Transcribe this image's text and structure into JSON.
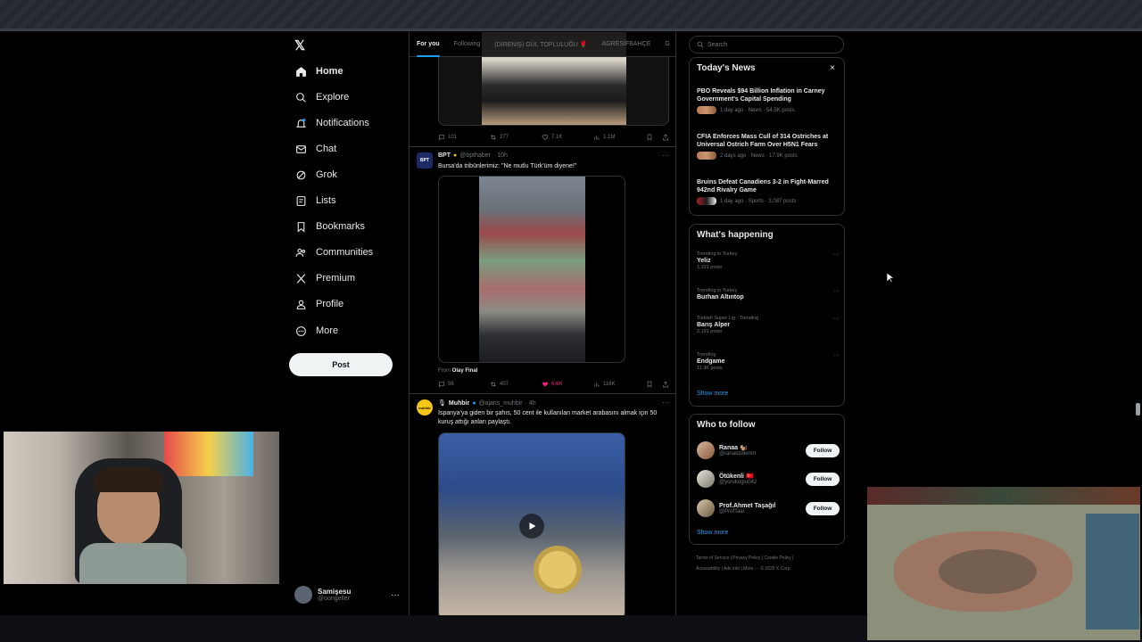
{
  "nav": {
    "logo": "𝕏",
    "items": [
      {
        "label": "Home",
        "icon": "home-icon"
      },
      {
        "label": "Explore",
        "icon": "search-icon"
      },
      {
        "label": "Notifications",
        "icon": "bell-icon"
      },
      {
        "label": "Chat",
        "icon": "mail-icon"
      },
      {
        "label": "Grok",
        "icon": "grok-icon"
      },
      {
        "label": "Lists",
        "icon": "list-icon"
      },
      {
        "label": "Bookmarks",
        "icon": "bookmark-icon"
      },
      {
        "label": "Communities",
        "icon": "people-icon"
      },
      {
        "label": "Premium",
        "icon": "x-icon"
      },
      {
        "label": "Profile",
        "icon": "person-icon"
      },
      {
        "label": "More",
        "icon": "more-circle-icon"
      }
    ],
    "post_label": "Post",
    "account": {
      "name": "Samişesu",
      "handle": "@oongeller"
    }
  },
  "tabs": [
    "For you",
    "Following",
    "(DİRENİŞ) GÜL TOPLULUĞU 🌹",
    "AGRESİFBAHÇE",
    "G"
  ],
  "feed": {
    "post0": {
      "stats": {
        "reply": "101",
        "repost": "277",
        "like": "7.1K",
        "views": "1.1M"
      }
    },
    "post1": {
      "name": "BPT",
      "handle": "@bpthaber",
      "time": "· 10h",
      "text": "Bursa'da tribünlerimiz: \"Ne mutlu Türk'üm diyene!\"",
      "from_prefix": "From",
      "from_name": "Olay Final",
      "avatar_text": "BPT",
      "stats": {
        "reply": "56",
        "repost": "407",
        "like": "6.6K",
        "views": "116K"
      }
    },
    "post2": {
      "name": "Muhbir",
      "handle": "@ajans_muhbir",
      "time": "· 4h",
      "avatar_text": "muhbir",
      "text": "İspanya'ya giden bir şahıs, 50 cent ile kullanılan market arabasını almak için 50 kuruş attığı anları paylaştı."
    }
  },
  "search": {
    "placeholder": "Search"
  },
  "news": {
    "title": "Today's News",
    "items": [
      {
        "title": "PBO Reveals $94 Billion Inflation in Carney Government's Capital Spending",
        "meta": "1 day ago · News · 54.5K posts"
      },
      {
        "title": "CFIA Enforces Mass Cull of 314 Ostriches at Universal Ostrich Farm Over H5N1 Fears",
        "meta": "2 days ago · News · 17.9K posts"
      },
      {
        "title": "Bruins Defeat Canadiens 3-2 in Fight-Marred 942nd Rivalry Game",
        "meta": "1 day ago · Sports · 3,087 posts"
      }
    ]
  },
  "happening": {
    "title": "What's happening",
    "items": [
      {
        "context": "Trending in Turkey",
        "name": "Yeliz",
        "posts": "1,131 posts"
      },
      {
        "context": "Trending in Turkey",
        "name": "Burhan Altıntop",
        "posts": ""
      },
      {
        "context": "Turkish Super Lig · Trending",
        "name": "Barış Alper",
        "posts": "2,191 posts"
      },
      {
        "context": "Trending",
        "name": "Endgame",
        "posts": "11.3K posts"
      }
    ],
    "show_more": "Show more"
  },
  "who": {
    "title": "Who to follow",
    "items": [
      {
        "name": "Ranaa 🐿️",
        "handle": "@ranaozdemm",
        "follow": "Follow"
      },
      {
        "name": "Ötükenli 🇹🇷",
        "handle": "@yorukoglu042",
        "follow": "Follow"
      },
      {
        "name": "Prof.Ahmet Taşağıl",
        "handle": "@ProfTaal",
        "follow": "Follow"
      }
    ],
    "show_more": "Show more"
  },
  "footer": {
    "line1": "Terms of Service  |  Privacy Policy  |  Cookie Policy  |",
    "line2": "Accessibility  |  Ads info  |  More ···  © 2025 X Corp."
  },
  "colors": {
    "accent": "#1d9bf0",
    "like": "#f91880",
    "background": "#000000",
    "border": "#2f3336"
  }
}
